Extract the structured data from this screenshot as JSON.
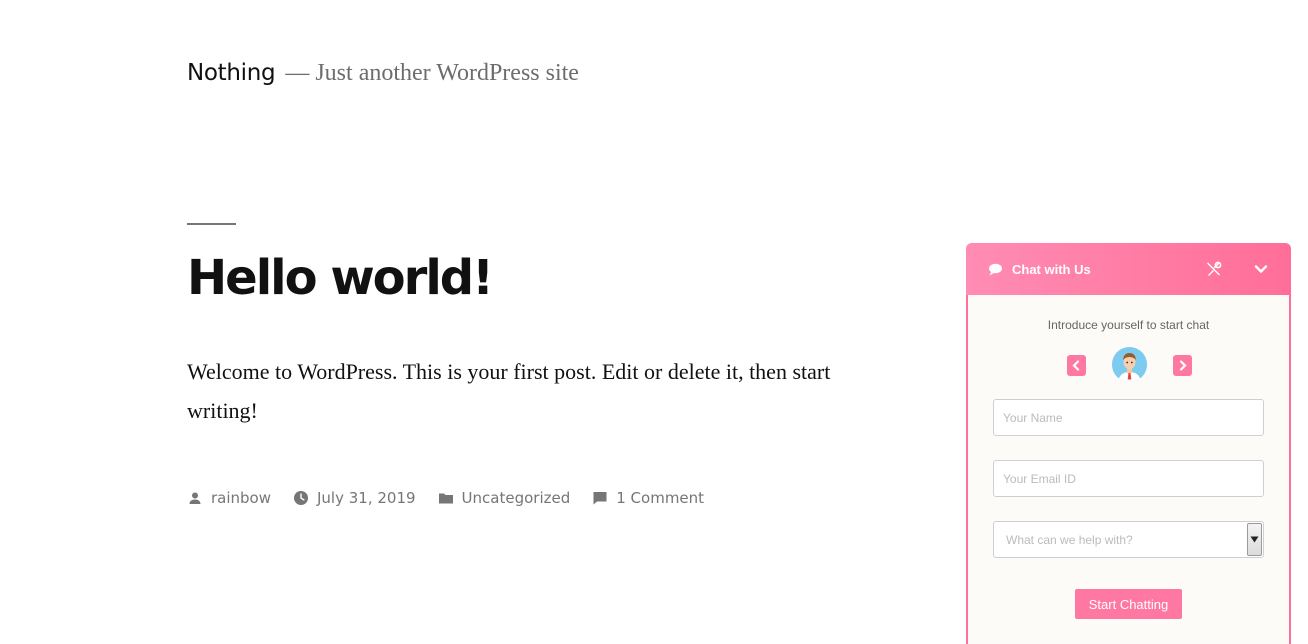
{
  "site": {
    "title": "Nothing",
    "description": "— Just another WordPress site"
  },
  "post": {
    "title": "Hello world!",
    "content": "Welcome to WordPress. This is your first post. Edit or delete it, then start writing!",
    "meta": {
      "author": "rainbow",
      "date": "July 31, 2019",
      "category": "Uncategorized",
      "comments": "1 Comment"
    }
  },
  "chat": {
    "title": "Chat with Us",
    "intro": "Introduce yourself to start chat",
    "name_placeholder": "Your Name",
    "email_placeholder": "Your Email ID",
    "topic_selected": "What can we help with?",
    "start_button": "Start Chatting",
    "accent_color": "#ff78a3"
  }
}
